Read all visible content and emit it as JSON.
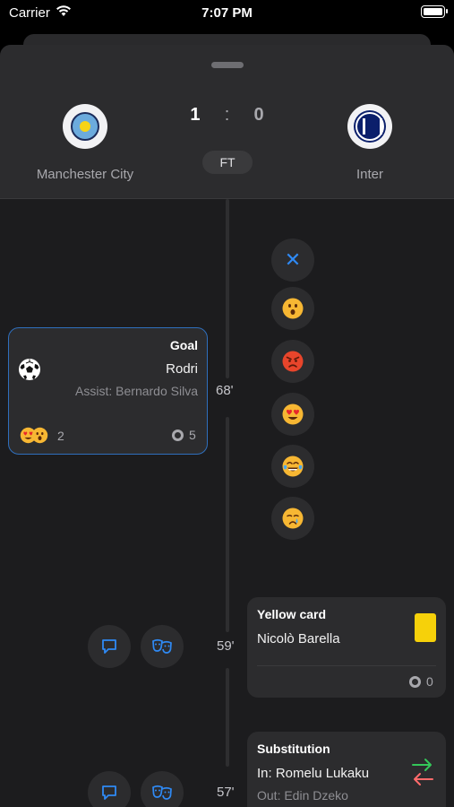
{
  "status_bar": {
    "carrier": "Carrier",
    "time": "7:07 PM"
  },
  "match": {
    "home_team": "Manchester City",
    "away_team": "Inter",
    "home_score": "1",
    "score_separator": ":",
    "away_score": "0",
    "status": "FT"
  },
  "events": [
    {
      "type": "Goal",
      "player": "Rodri",
      "detail": "Assist: Bernardo Silva",
      "minute": "68'",
      "reaction_icons": [
        "heart-eyes-icon",
        "surprised-icon"
      ],
      "reaction_count": "2",
      "comment_count": "5"
    },
    {
      "type": "Yellow card",
      "player": "Nicolò Barella",
      "minute": "59'",
      "comment_count": "0"
    },
    {
      "type": "Substitution",
      "player": "In: Romelu Lukaku",
      "detail": "Out: Edin Dzeko",
      "minute": "57'"
    }
  ],
  "reaction_picker": [
    "close-icon",
    "surprised-icon",
    "angry-icon",
    "heart-eyes-icon",
    "tears-of-joy-icon",
    "crying-icon"
  ],
  "colors": {
    "accent": "#2f8af5",
    "card_border": "#2f6fbd",
    "yellow_card": "#f6d10a",
    "sub_in": "#34c759",
    "sub_out": "#ff6b6b",
    "emoji_yellow": "#f7b733"
  }
}
